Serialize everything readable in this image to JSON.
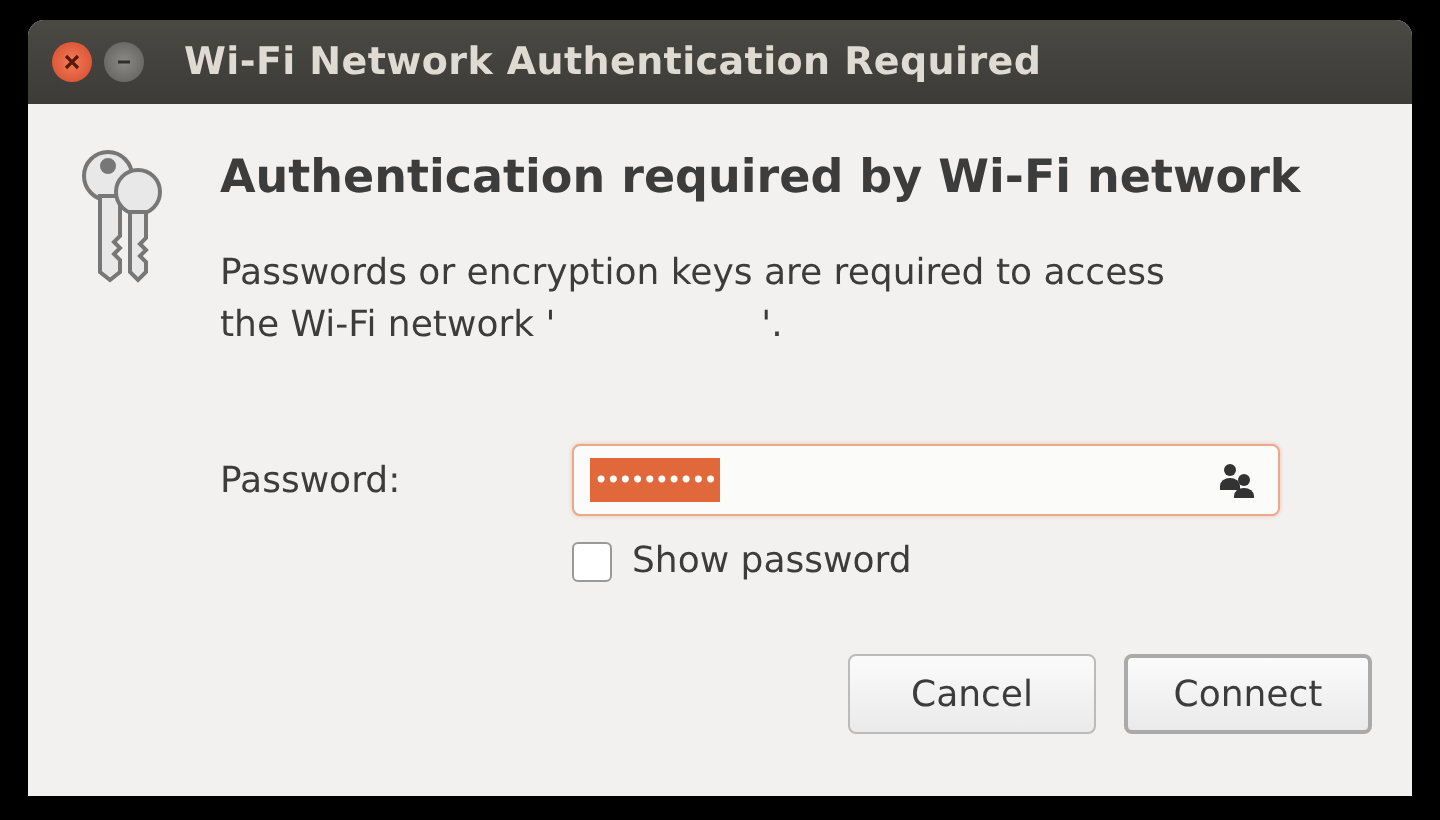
{
  "window": {
    "title": "Wi-Fi Network Authentication Required",
    "controls": [
      {
        "kind": "close"
      },
      {
        "kind": "minimize"
      }
    ]
  },
  "heading": "Authentication required by Wi-Fi network",
  "description": "Passwords or encryption keys are required to access the Wi-Fi network '                  '.",
  "password": {
    "label": "Password:",
    "value": "••••••••••",
    "text_selected": true,
    "focused": true
  },
  "show_password": {
    "label": "Show password",
    "checked": false
  },
  "buttons": [
    {
      "label": "Cancel",
      "default": false
    },
    {
      "label": "Connect",
      "default": true
    }
  ]
}
